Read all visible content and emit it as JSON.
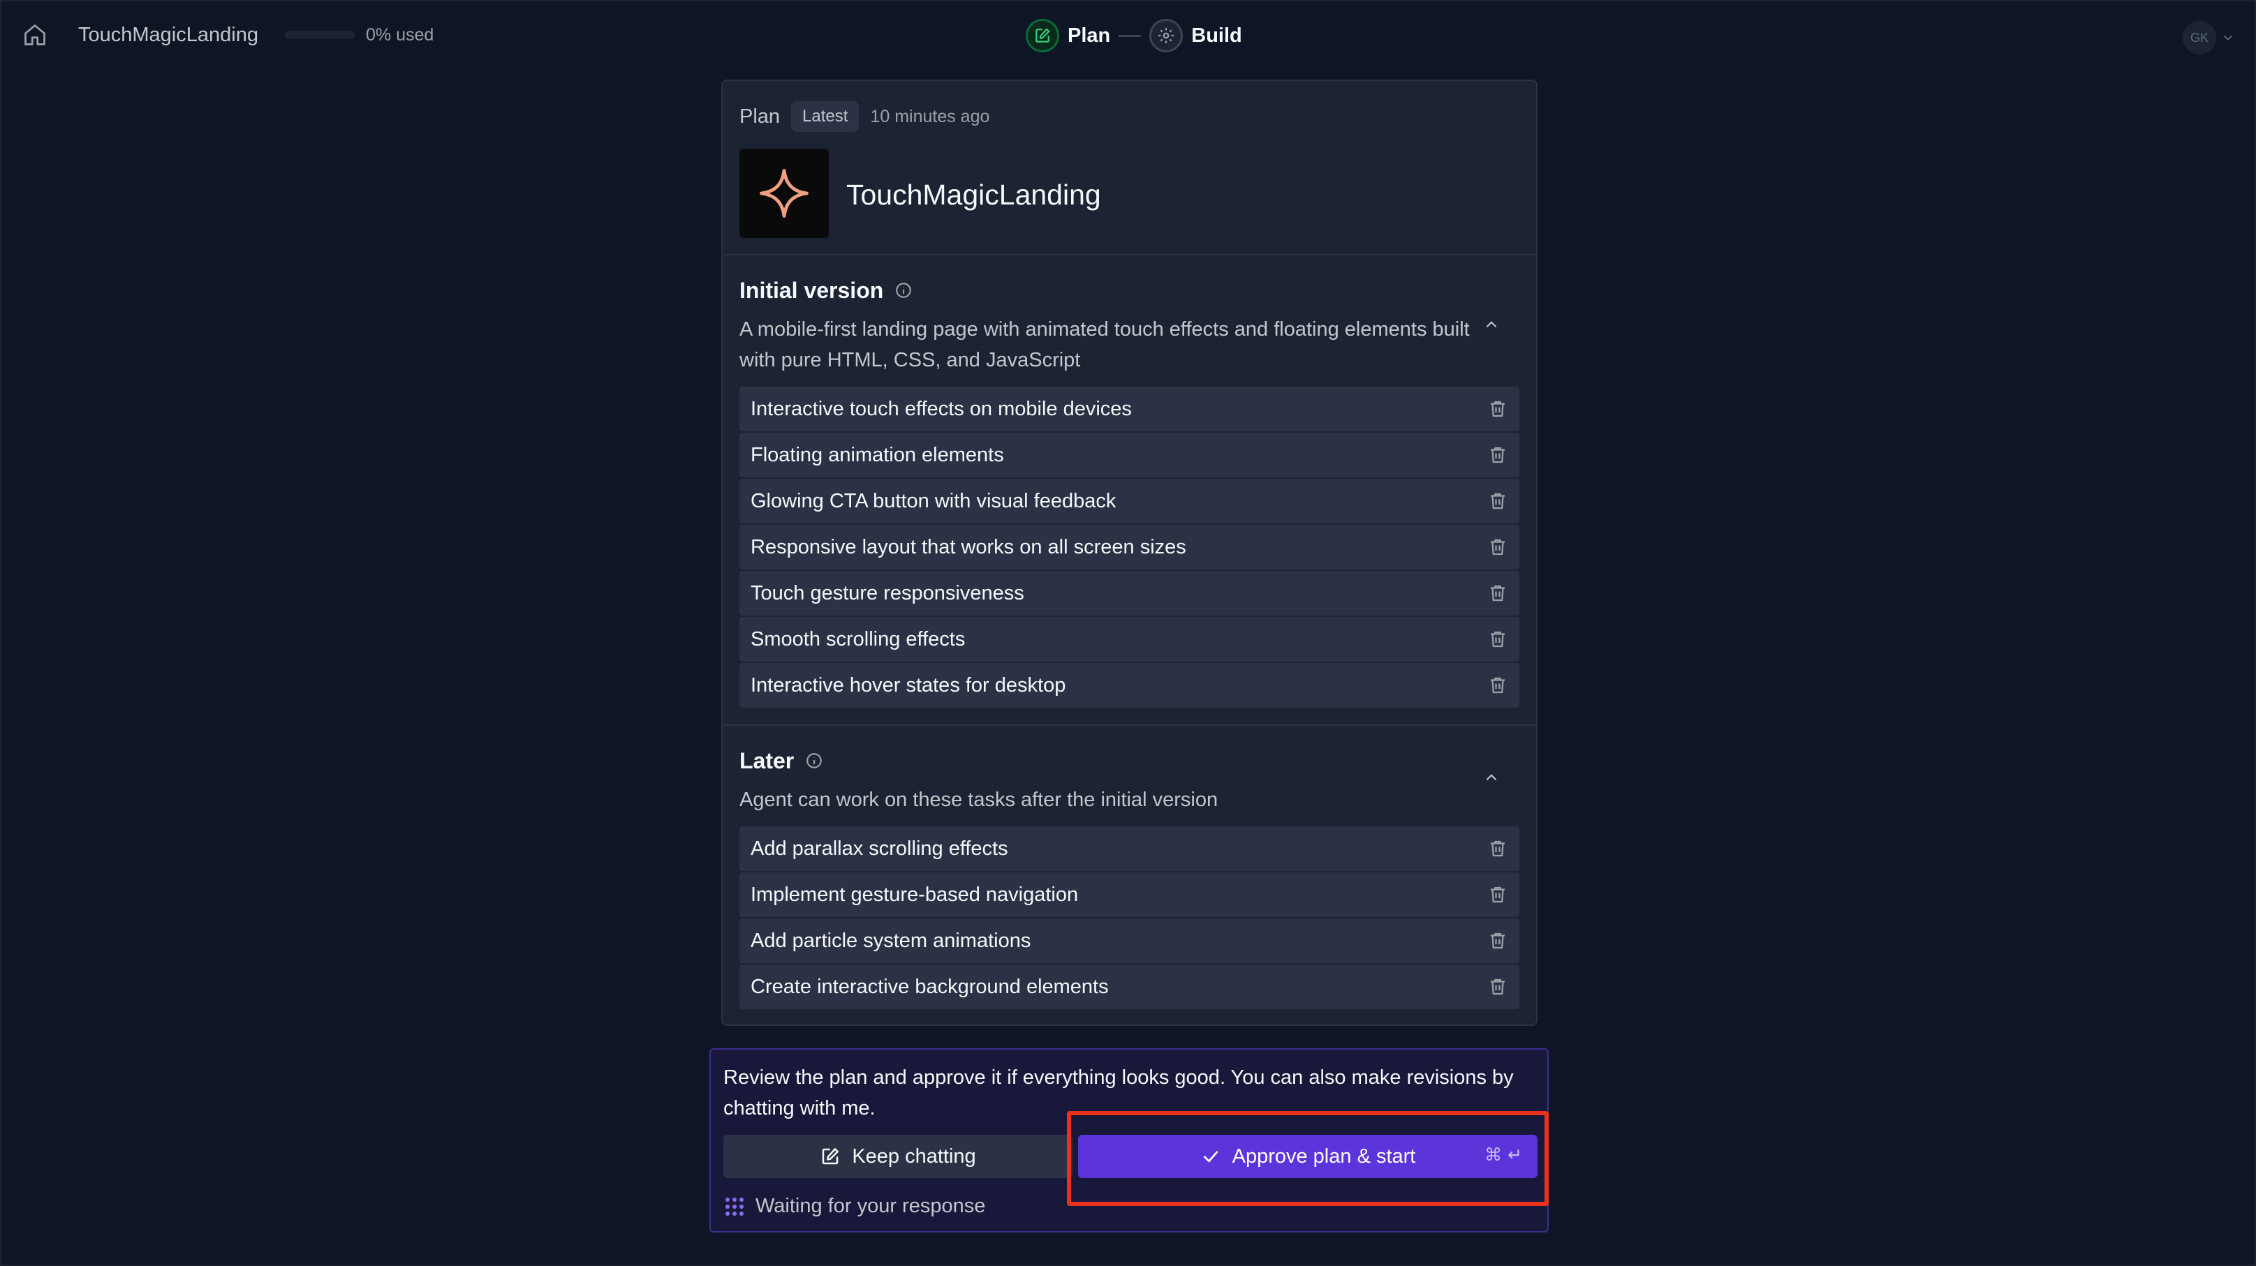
{
  "topbar": {
    "project_name": "TouchMagicLanding",
    "usage_text": "0% used",
    "usage_fraction": 0.0,
    "steps": [
      {
        "label": "Plan",
        "icon": "edit-icon"
      },
      {
        "label": "Build",
        "icon": "gear-icon"
      }
    ],
    "avatar_initials": "GK"
  },
  "plan": {
    "label": "Plan",
    "badge": "Latest",
    "time": "10 minutes ago",
    "app_title": "TouchMagicLanding",
    "logo_icon": "sparkle-icon",
    "logo_color": "#f0a080"
  },
  "initial": {
    "title": "Initial version",
    "description": "A mobile-first landing page with animated touch effects and floating elements built with pure HTML, CSS, and JavaScript",
    "items": [
      "Interactive touch effects on mobile devices",
      "Floating animation elements",
      "Glowing CTA button with visual feedback",
      "Responsive layout that works on all screen sizes",
      "Touch gesture responsiveness",
      "Smooth scrolling effects",
      "Interactive hover states for desktop"
    ]
  },
  "later": {
    "title": "Later",
    "description": "Agent can work on these tasks after the initial version",
    "items": [
      "Add parallax scrolling effects",
      "Implement gesture-based navigation",
      "Add particle system animations",
      "Create interactive background elements"
    ]
  },
  "review": {
    "message": "Review the plan and approve it if everything looks good. You can also make revisions by chatting with me.",
    "keep_label": "Keep chatting",
    "approve_label": "Approve plan & start",
    "shortcut": "⌘ ↵",
    "waiting": "Waiting for your response",
    "accent_color": "#5b34da",
    "highlight_color": "#e8321e"
  }
}
